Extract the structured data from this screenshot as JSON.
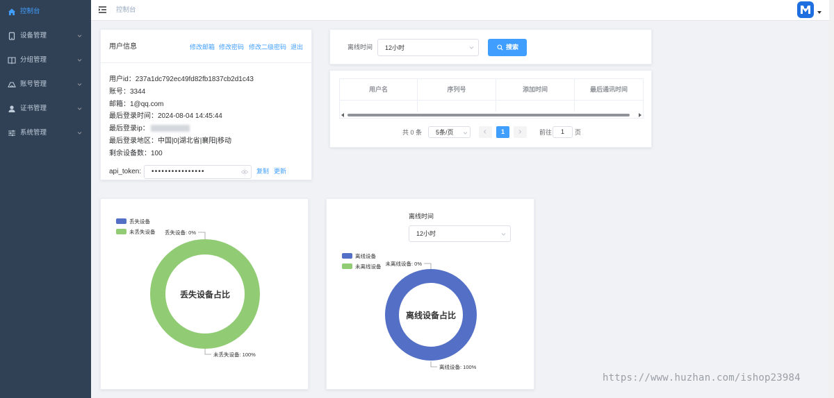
{
  "sidebar": {
    "items": [
      {
        "label": "控制台",
        "icon": "home-icon",
        "active": true,
        "has_arrow": false
      },
      {
        "label": "设备管理",
        "icon": "tablet-icon",
        "active": false,
        "has_arrow": true
      },
      {
        "label": "分组管理",
        "icon": "book-icon",
        "active": false,
        "has_arrow": true
      },
      {
        "label": "账号管理",
        "icon": "shelter-icon",
        "active": false,
        "has_arrow": true
      },
      {
        "label": "证书管理",
        "icon": "user-icon",
        "active": false,
        "has_arrow": true
      },
      {
        "label": "系统管理",
        "icon": "sliders-icon",
        "active": false,
        "has_arrow": true
      }
    ]
  },
  "header": {
    "breadcrumb": "控制台"
  },
  "user_info": {
    "title": "用户信息",
    "links": [
      "修改邮箱",
      "修改密码",
      "修改二级密码",
      "退出"
    ],
    "lines": [
      "用户id：237a1dc792ec49fd82fb1837cb2d1c43",
      "账号：3344",
      "邮箱：1@qq.com",
      "最后登录时间：2024-08-04 14:45:44",
      "最后登录ip：",
      "最后登录地区：中国|0|湖北省|襄阳|移动",
      "剩余设备数：100"
    ],
    "token_label": "api_token:",
    "token_mask": "••••••••••••••••",
    "copy_label": "复制",
    "refresh_label": "更新"
  },
  "search": {
    "label": "离线时间",
    "select_value": "12小时",
    "button_label": "搜索"
  },
  "table": {
    "columns": [
      "用户名",
      "序列号",
      "添加时间",
      "最后通讯时间"
    ]
  },
  "pagination": {
    "total": "共 0 条",
    "page_size": "5条/页",
    "current_page": "1",
    "goto_label": "前往",
    "goto_value": "1",
    "page_suffix": "页"
  },
  "chart_data": [
    {
      "type": "pie",
      "title": "丢失设备占比",
      "categories": [
        "丢失设备",
        "未丢失设备"
      ],
      "values": [
        0,
        100
      ],
      "colors": [
        "#5470c6",
        "#91cc75"
      ],
      "labels": [
        "丢失设备: 0%",
        "未丢失设备: 100%"
      ],
      "legend": "top-left"
    },
    {
      "type": "pie",
      "title": "离线设备占比",
      "filter_label": "离线时间",
      "filter_value": "12小时",
      "categories": [
        "离线设备",
        "未离线设备"
      ],
      "values": [
        100,
        0
      ],
      "colors": [
        "#5470c6",
        "#91cc75"
      ],
      "labels": [
        "离线设备: 100%",
        "未离线设备: 0%"
      ],
      "legend": "top-left"
    }
  ],
  "watermark": "https://www.huzhan.com/ishop23984",
  "colors": {
    "sidebar_bg": "#304156",
    "accent": "#409eff"
  }
}
